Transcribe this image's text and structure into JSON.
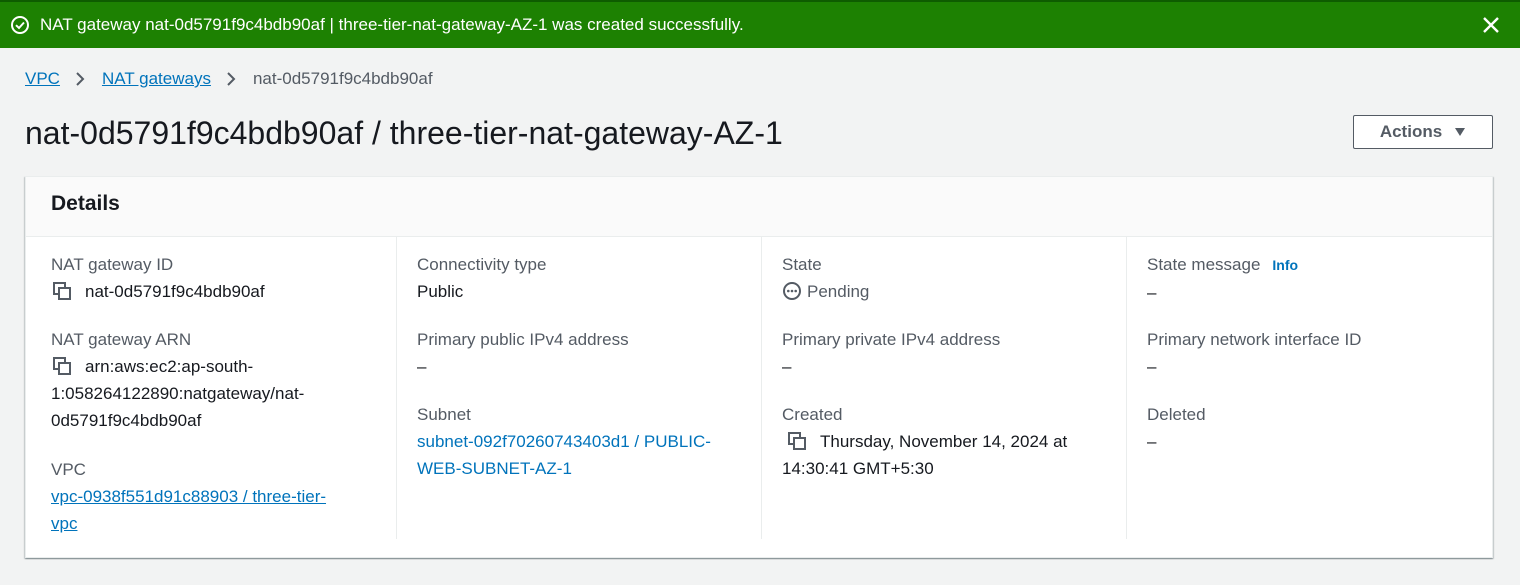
{
  "flash": {
    "message": "NAT gateway nat-0d5791f9c4bdb90af | three-tier-nat-gateway-AZ-1 was created successfully.",
    "color": "#1d8102"
  },
  "breadcrumb": [
    "VPC",
    "NAT gateways",
    "nat-0d5791f9c4bdb90af"
  ],
  "page_title": "nat-0d5791f9c4bdb90af / three-tier-nat-gateway-AZ-1",
  "actions_label": "Actions",
  "details": {
    "title": "Details",
    "nat_gateway_id": {
      "label": "NAT gateway ID",
      "value": "nat-0d5791f9c4bdb90af"
    },
    "nat_gateway_arn": {
      "label": "NAT gateway ARN",
      "value_line1": "arn:aws:ec2:ap-south-",
      "value_line2": "1:058264122890:natgateway/nat-",
      "value_line3": "0d5791f9c4bdb90af"
    },
    "vpc": {
      "label": "VPC",
      "value_line1": "vpc-0938f551d91c88903 / three-tier-",
      "value_line2": "vpc"
    },
    "connectivity_type": {
      "label": "Connectivity type",
      "value": "Public"
    },
    "primary_public_ipv4": {
      "label": "Primary public IPv4 address",
      "value": "–"
    },
    "subnet": {
      "label": "Subnet",
      "value_line1": "subnet-092f70260743403d1 / PUBLIC-",
      "value_line2": "WEB-SUBNET-AZ-1"
    },
    "state": {
      "label": "State",
      "value": "Pending"
    },
    "primary_private_ipv4": {
      "label": "Primary private IPv4 address",
      "value": "–"
    },
    "created": {
      "label": "Created",
      "value_line1": "Thursday, November 14, 2024 at",
      "value_line2": "14:30:41 GMT+5:30"
    },
    "state_message": {
      "label": "State message",
      "info": "Info",
      "value": "–"
    },
    "primary_network_interface_id": {
      "label": "Primary network interface ID",
      "value": "–"
    },
    "deleted": {
      "label": "Deleted",
      "value": "–"
    }
  },
  "icons": [
    "check-circle-icon",
    "close-icon",
    "chevron-right-icon",
    "caret-down-icon",
    "copy-icon",
    "pending-icon"
  ],
  "colors": {
    "link": "#0073bb",
    "text": "#16191f",
    "label": "#545b64"
  }
}
